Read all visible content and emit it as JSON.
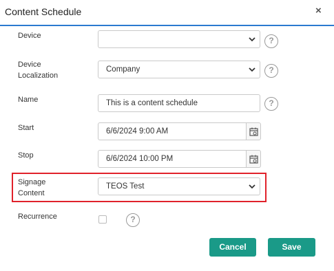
{
  "dialog": {
    "title": "Content Schedule"
  },
  "fields": {
    "device": {
      "label": "Device",
      "value": ""
    },
    "device_localization": {
      "label_line1": "Device",
      "label_line2": "Localization",
      "value": "Company"
    },
    "name": {
      "label": "Name",
      "value": "This is a content schedule"
    },
    "start": {
      "label": "Start",
      "value": "6/6/2024 9:00 AM"
    },
    "stop": {
      "label": "Stop",
      "value": "6/6/2024 10:00 PM"
    },
    "signage_content": {
      "label_line1": "Signage",
      "label_line2": "Content",
      "value": "TEOS Test"
    },
    "recurrence": {
      "label": "Recurrence",
      "checked": false
    }
  },
  "help_glyph": "?",
  "close_glyph": "×",
  "buttons": {
    "cancel": "Cancel",
    "save": "Save"
  },
  "colors": {
    "accent": "#2a7ad0",
    "button": "#1a9a88",
    "highlight": "#e0212a"
  }
}
